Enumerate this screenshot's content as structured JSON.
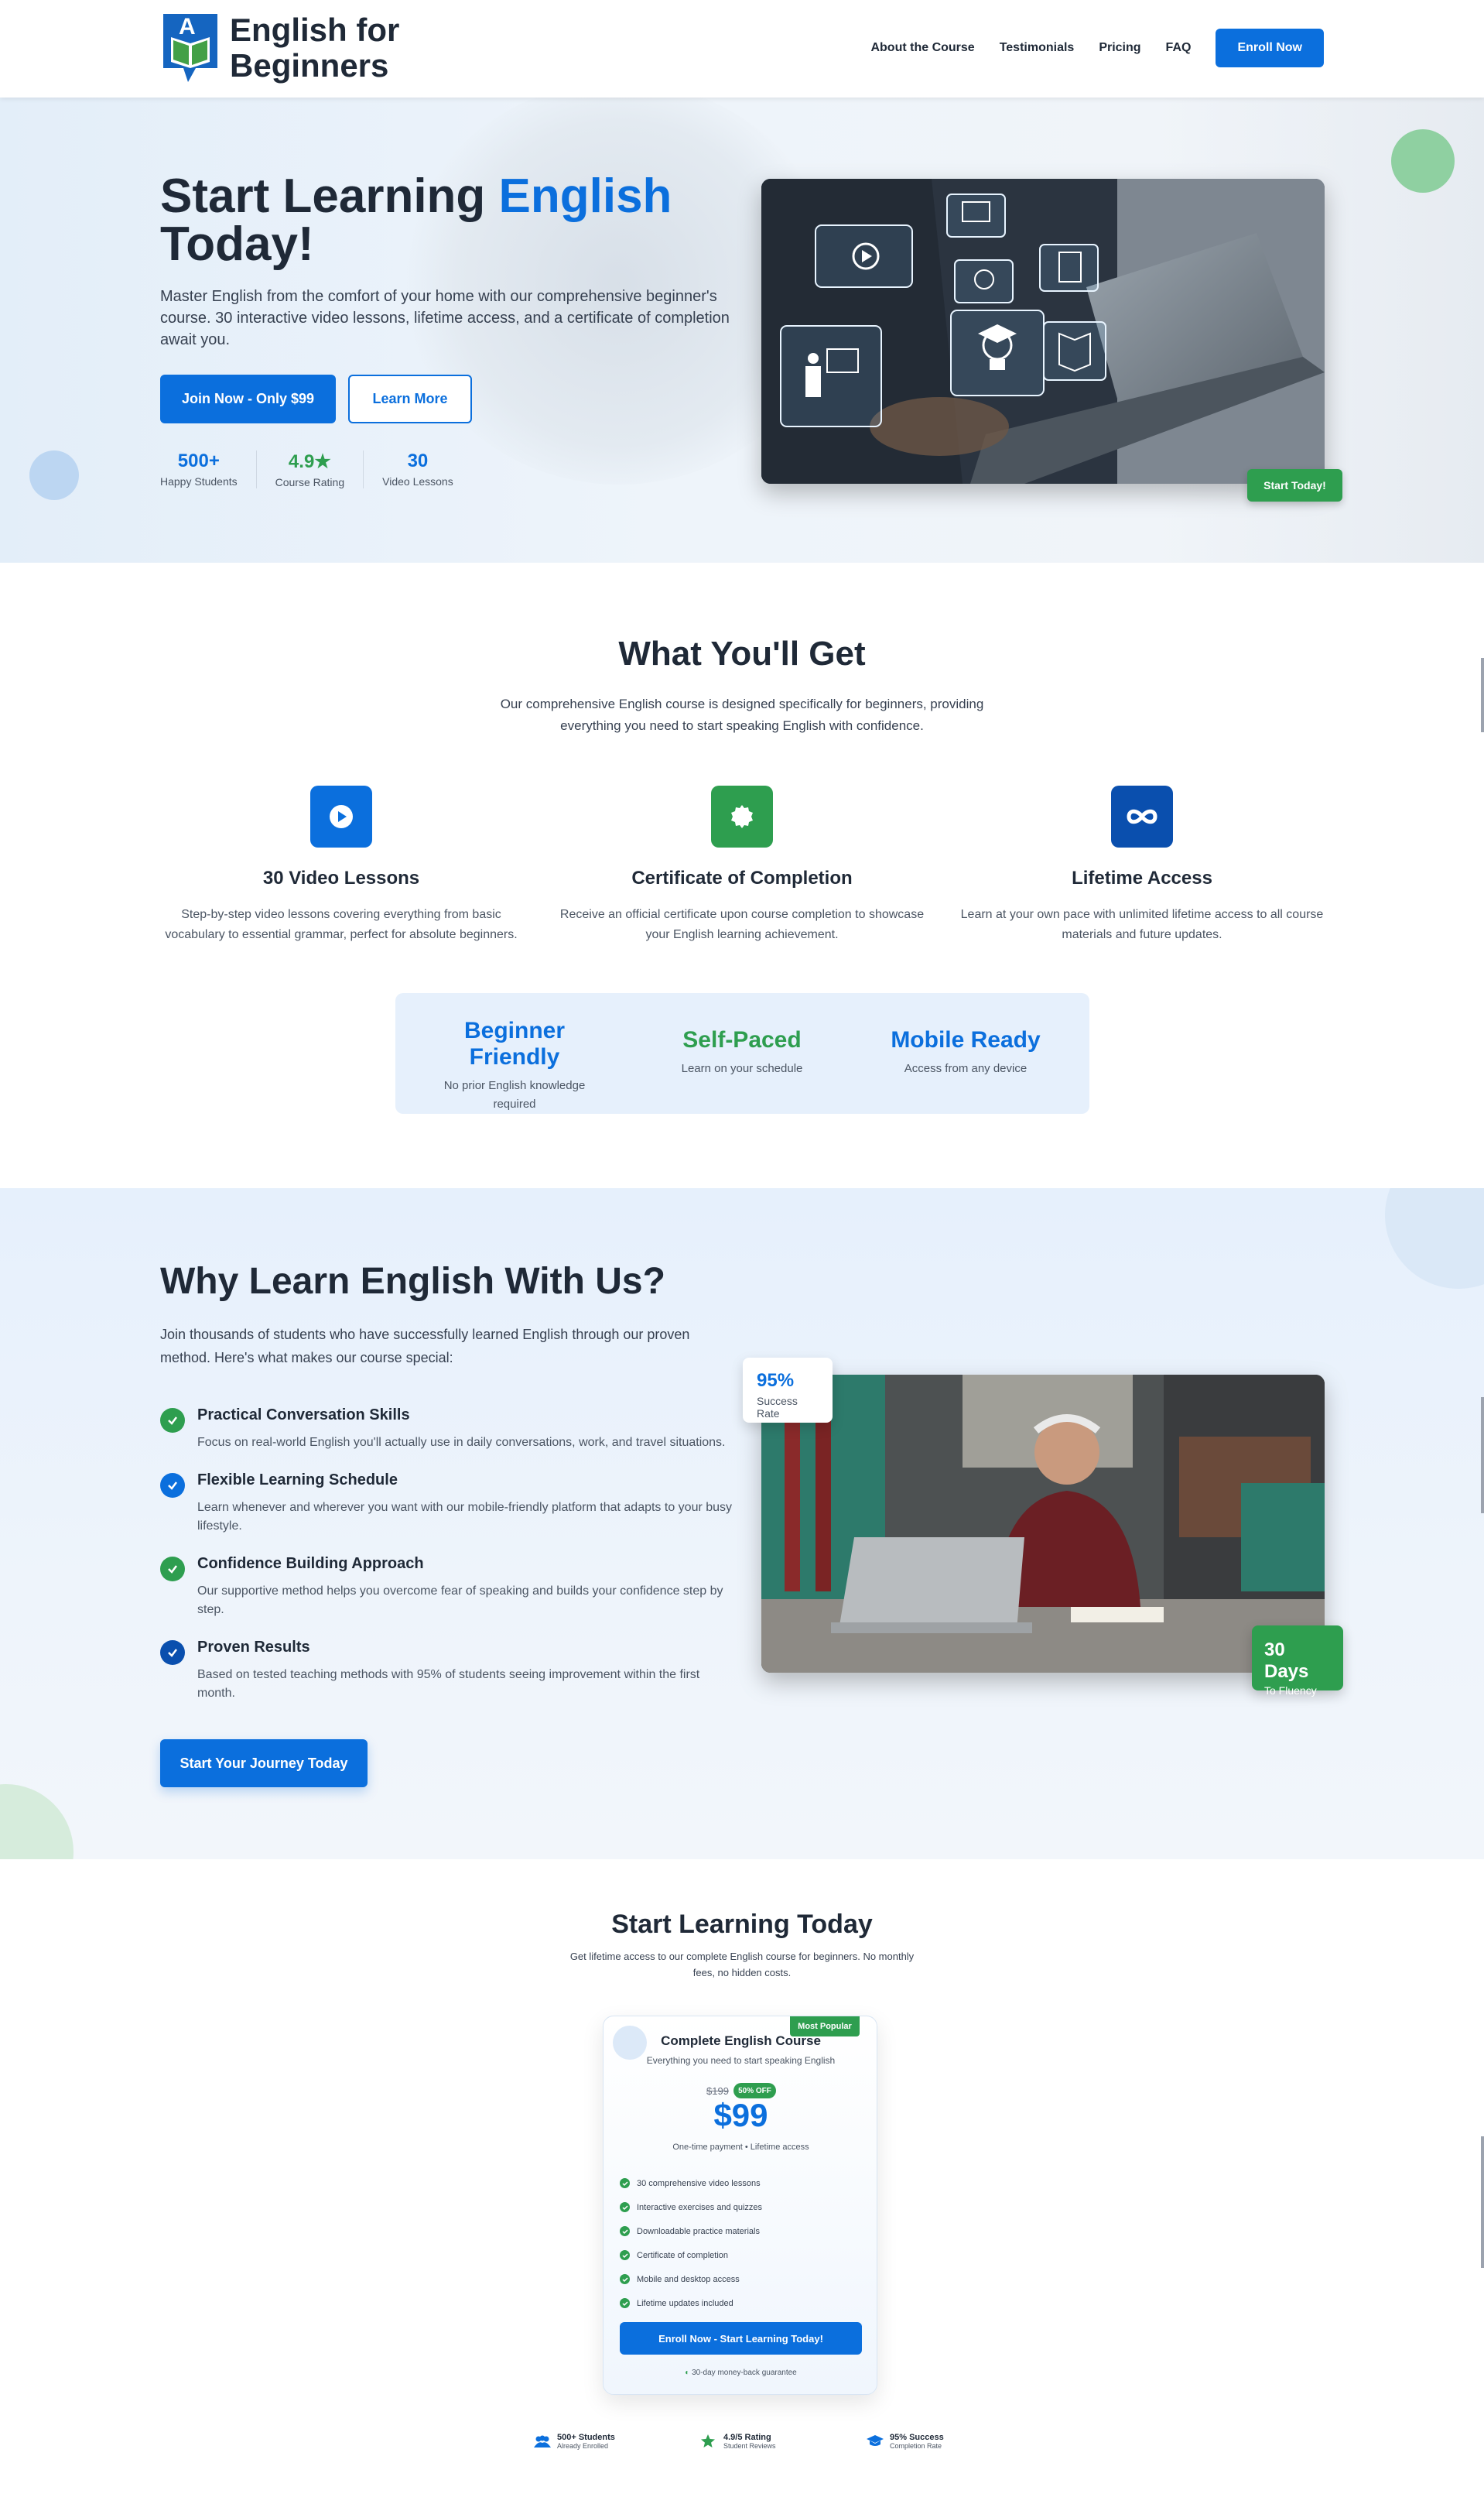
{
  "nav": {
    "logo_text": "English for Beginners",
    "logo_letter": "A",
    "links": [
      "About the Course",
      "Testimonials",
      "Pricing",
      "FAQ"
    ],
    "cta": "Enroll Now"
  },
  "hero": {
    "title_part1": "Start Learning ",
    "title_accent": "English",
    "title_part2": "Today!",
    "subtitle": "Master English from the comfort of your home with our comprehensive beginner's course. 30 interactive video lessons, lifetime access, and a certificate of completion await you.",
    "primary_button": "Join Now - Only $99",
    "secondary_button": "Learn More",
    "stats": [
      {
        "value": "500+",
        "label": "Happy Students"
      },
      {
        "value": "4.9★",
        "label": "Course Rating"
      },
      {
        "value": "30",
        "label": "Video Lessons"
      }
    ],
    "image_badge": "Start Today!"
  },
  "features": {
    "title": "What You'll Get",
    "subtitle": "Our comprehensive English course is designed specifically for beginners, providing everything you need to start speaking English with confidence.",
    "items": [
      {
        "title": "30 Video Lessons",
        "desc": "Step-by-step video lessons covering everything from basic vocabulary to essential grammar, perfect for absolute beginners.",
        "icon": "play-icon"
      },
      {
        "title": "Certificate of Completion",
        "desc": "Receive an official certificate upon course completion to showcase your English learning achievement.",
        "icon": "certificate-icon"
      },
      {
        "title": "Lifetime Access",
        "desc": "Learn at your own pace with unlimited lifetime access to all course materials and future updates.",
        "icon": "infinity-icon"
      }
    ],
    "highlights": [
      {
        "title": "Beginner Friendly",
        "desc": "No prior English knowledge required",
        "color": "#0b6fdd"
      },
      {
        "title": "Self-Paced",
        "desc": "Learn on your schedule",
        "color": "#2e9e4f"
      },
      {
        "title": "Mobile Ready",
        "desc": "Access from any device",
        "color": "#0b6fdd"
      }
    ]
  },
  "why": {
    "title": "Why Learn English With Us?",
    "subtitle": "Join thousands of students who have successfully learned English through our proven method. Here's what makes our course special:",
    "items": [
      {
        "title": "Practical Conversation Skills",
        "desc": "Focus on real-world English you'll actually use in daily conversations, work, and travel situations."
      },
      {
        "title": "Flexible Learning Schedule",
        "desc": "Learn whenever and wherever you want with our mobile-friendly platform that adapts to your busy lifestyle."
      },
      {
        "title": "Confidence Building Approach",
        "desc": "Our supportive method helps you overcome fear of speaking and builds your confidence step by step."
      },
      {
        "title": "Proven Results",
        "desc": "Based on tested teaching methods with 95% of students seeing improvement within the first month."
      }
    ],
    "button": "Start Your Journey Today",
    "rate_badge": {
      "value": "95%",
      "label": "Success Rate"
    },
    "days_badge": {
      "value": "30 Days",
      "label": "To Fluency"
    }
  },
  "pricing": {
    "title": "Start Learning Today",
    "subtitle": "Get lifetime access to our complete English course for beginners. No monthly fees, no hidden costs.",
    "card": {
      "badge": "Most Popular",
      "title": "Complete English Course",
      "subtitle": "Everything you need to start speaking English",
      "original_price": "$199",
      "discount": "50% OFF",
      "price": "$99",
      "note": "One-time payment • Lifetime access",
      "features": [
        "30 comprehensive video lessons",
        "Interactive exercises and quizzes",
        "Downloadable practice materials",
        "Certificate of completion",
        "Mobile and desktop access",
        "Lifetime updates included"
      ],
      "button": "Enroll Now - Start Learning Today!",
      "guarantee": "30-day money-back guarantee"
    },
    "trust": [
      {
        "title": "500+ Students",
        "desc": "Already Enrolled",
        "icon": "users-icon"
      },
      {
        "title": "4.9/5 Rating",
        "desc": "Student Reviews",
        "icon": "star-icon"
      },
      {
        "title": "95% Success",
        "desc": "Completion Rate",
        "icon": "graduation-cap-icon"
      }
    ]
  },
  "colors": {
    "primary": "#0b6fdd",
    "green": "#2e9e4f",
    "text": "#1f2937"
  }
}
